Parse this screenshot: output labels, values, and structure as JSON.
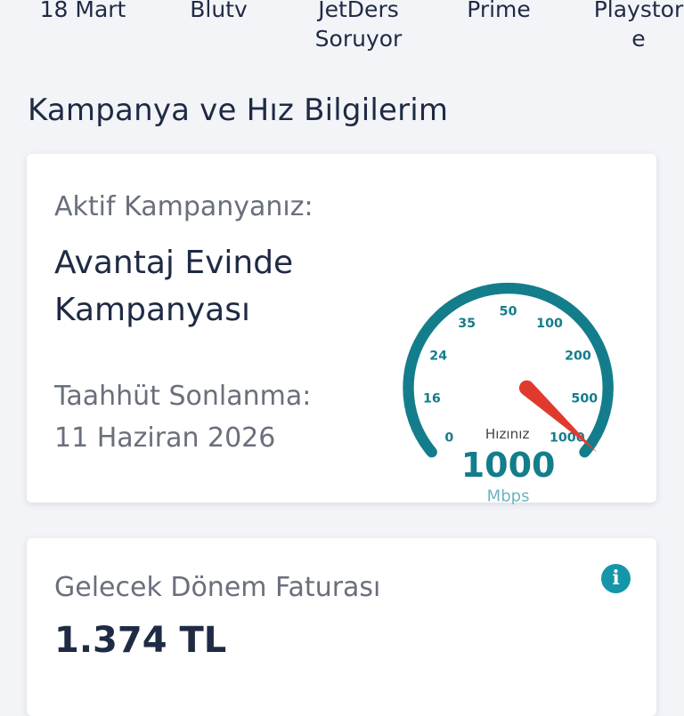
{
  "tabs": [
    "18 Mart",
    "Blutv",
    "JetDers\nSoruyor",
    "Prime",
    "Playstor\ne"
  ],
  "section_title": "Kampanya ve Hız Bilgilerim",
  "campaign": {
    "active_label": "Aktif Kampanyanız:",
    "name": "Avantaj Evinde Kampanyası",
    "commitment_label": "Taahhüt Sonlanma:",
    "commitment_date": "11 Haziran 2026"
  },
  "speedometer": {
    "scale_labels": [
      "0",
      "16",
      "24",
      "35",
      "50",
      "100",
      "200",
      "500",
      "1000"
    ],
    "caption": "Hızınız",
    "speed_value": "1000",
    "unit": "Mbps",
    "needle_level": 1.0,
    "colors": {
      "arc": "#147d8c",
      "needle": "#e03a2f",
      "value": "#147d8c",
      "unit": "#6fb3c0"
    }
  },
  "invoice": {
    "label": "Gelecek Dönem Faturası",
    "amount": "1.374 TL",
    "icon": "info-icon"
  },
  "colors": {
    "accent": "#1496a8",
    "text": "#1f2a44",
    "muted": "#6a6f7c",
    "background": "#f3f4f8"
  }
}
